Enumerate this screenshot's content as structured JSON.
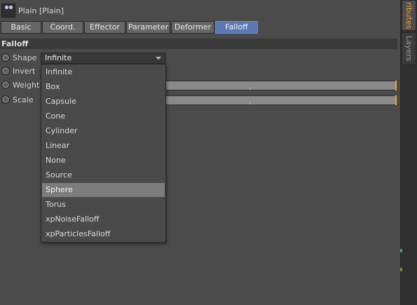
{
  "sidebar": {
    "tabs": [
      {
        "label": "ributes",
        "active": true
      },
      {
        "label": "Layers",
        "active": false
      }
    ],
    "accent_color": "#f2a23a"
  },
  "object": {
    "title": "Plain [Plain]",
    "icon": "plain-effector-icon"
  },
  "tabs": [
    {
      "label": "Basic",
      "active": false
    },
    {
      "label": "Coord.",
      "active": false
    },
    {
      "label": "Effector",
      "active": false
    },
    {
      "label": "Parameter",
      "active": false
    },
    {
      "label": "Deformer",
      "active": false
    },
    {
      "label": "Falloff",
      "active": true
    }
  ],
  "section": {
    "title": "Falloff"
  },
  "params": {
    "shape": {
      "label": "Shape",
      "value": "Infinite"
    },
    "invert": {
      "label": "Invert"
    },
    "weight": {
      "label": "Weight"
    },
    "scale": {
      "label": "Scale"
    }
  },
  "dropdown": {
    "options": [
      "Infinite",
      "Box",
      "Capsule",
      "Cone",
      "Cylinder",
      "Linear",
      "None",
      "Source",
      "Sphere",
      "Torus",
      "xpNoiseFalloff",
      "xpParticlesFalloff"
    ],
    "highlighted": "Sphere"
  },
  "colors": {
    "active_tab": "#5b78b6",
    "background": "#4b4b4b",
    "slider_end": "#f0a030"
  }
}
